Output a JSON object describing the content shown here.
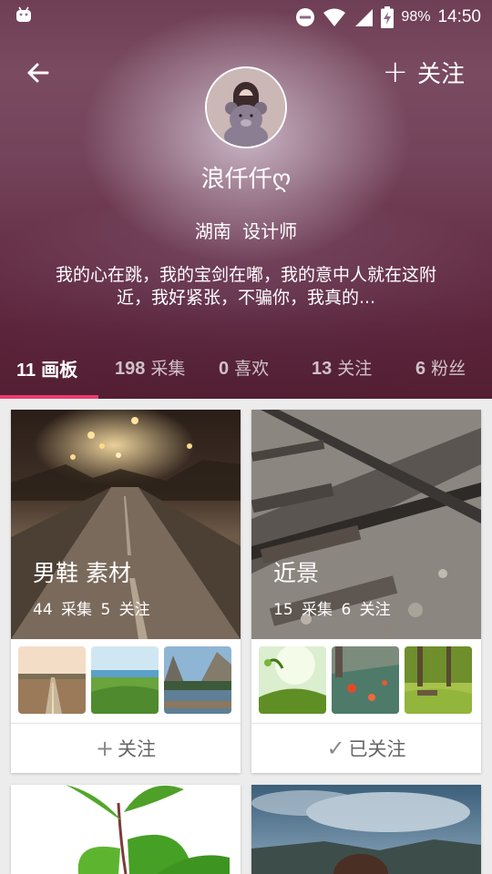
{
  "status_bar": {
    "battery_percent": "98%",
    "time": "14:50",
    "icons": [
      "android-icon",
      "do-not-disturb-icon",
      "wifi-icon",
      "signal-icon",
      "battery-charging-icon"
    ]
  },
  "toolbar": {
    "back_icon": "arrow-left-icon",
    "follow_plus": "+",
    "follow_label": "关注"
  },
  "profile": {
    "name": "浪仟仟ღ",
    "location": "湖南 设计师",
    "bio": "我的心在跳，我的宝剑在嘟，我的意中人就在这附近，我好紧张，不骗你，我真的..."
  },
  "tabs": [
    {
      "count": "11",
      "label": "画板",
      "active": true
    },
    {
      "count": "198",
      "label": "采集",
      "active": false
    },
    {
      "count": "0",
      "label": "喜欢",
      "active": false
    },
    {
      "count": "13",
      "label": "关注",
      "active": false
    },
    {
      "count": "6",
      "label": "粉丝",
      "active": false
    }
  ],
  "colors": {
    "accent": "#ec3c6e",
    "card_bg": "#ffffff",
    "page_bg": "#ececec"
  },
  "boards": [
    {
      "title": "男鞋 素材",
      "stats": "44 采集 5 关注",
      "action_glyph": "+",
      "action_label": "关注"
    },
    {
      "title": "近景",
      "stats": "15 采集 6 关注",
      "action_glyph": "✓",
      "action_label": "已关注"
    }
  ]
}
